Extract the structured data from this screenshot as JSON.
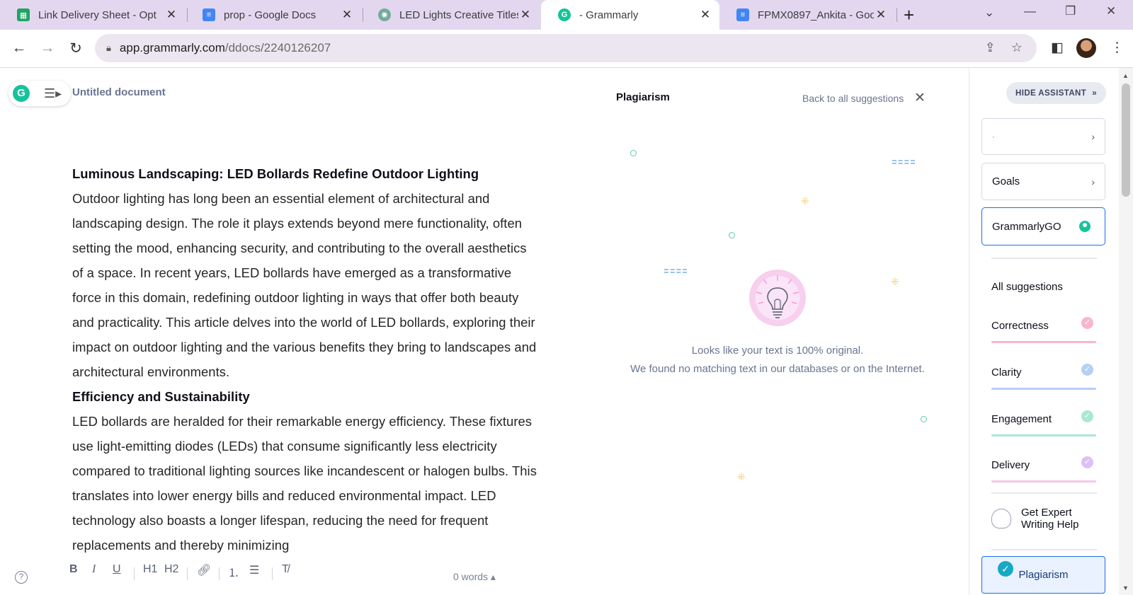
{
  "tabs": [
    {
      "title": "Link Delivery Sheet - Opt",
      "icon": "sheets-icon",
      "active": false
    },
    {
      "title": "prop - Google Docs",
      "icon": "docs-icon",
      "active": false
    },
    {
      "title": "LED Lights Creative Titles",
      "icon": "chatgpt-icon",
      "active": false
    },
    {
      "title": "- Grammarly",
      "icon": "grammarly-icon",
      "active": true
    },
    {
      "title": "FPMX0897_Ankita - Goog",
      "icon": "docs-icon",
      "active": false
    }
  ],
  "address": {
    "host": "app.grammarly.com",
    "path": "/ddocs/2240126207"
  },
  "document": {
    "title": "Untitled document",
    "heading1": "Luminous Landscaping: LED Bollards Redefine Outdoor Lighting",
    "para1": "Outdoor lighting has long been an essential element of architectural and landscaping design. The role it plays extends beyond mere functionality, often setting the mood, enhancing security, and contributing to the overall aesthetics of a space. In recent years, LED bollards have emerged as a transformative force in this domain, redefining outdoor lighting in ways that offer both beauty and practicality. This article delves into the world of LED bollards, exploring their impact on outdoor lighting and the various benefits they bring to landscapes and architectural environments.",
    "heading2": "Efficiency and Sustainability",
    "para2": "LED bollards are heralded for their remarkable energy efficiency. These fixtures use light-emitting diodes (LEDs) that consume significantly less electricity compared to traditional lighting sources like incandescent or halogen bulbs. This translates into lower energy bills and reduced environmental impact. LED technology also boasts a longer lifespan, reducing the need for frequent replacements and thereby minimizing",
    "word_count": "0 words"
  },
  "toolbar": {
    "bold": "B",
    "italic": "I",
    "underline": "U",
    "h1": "H1",
    "h2": "H2"
  },
  "plagiarism": {
    "title": "Plagiarism",
    "back": "Back to all suggestions",
    "message1": "Looks like your text is 100% original.",
    "message2": "We found no matching text in our databases or on the Internet."
  },
  "sidebar": {
    "hide_assistant": "HIDE ASSISTANT",
    "goals": "Goals",
    "grammarly_go": "GrammarlyGO",
    "all_suggestions": "All suggestions",
    "categories": [
      {
        "label": "Correctness",
        "color": "#f47fa1"
      },
      {
        "label": "Clarity",
        "color": "#7fa9f0"
      },
      {
        "label": "Engagement",
        "color": "#5fd3b0"
      },
      {
        "label": "Delivery",
        "color": "#c28ff0"
      }
    ],
    "expert": "Get Expert Writing Help",
    "plagiarism": "Plagiarism"
  }
}
